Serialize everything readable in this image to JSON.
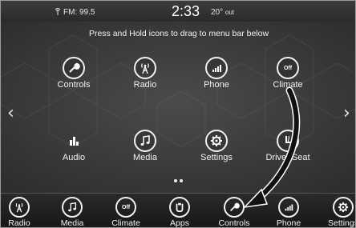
{
  "status": {
    "radio": "FM: 99.5",
    "time": "2:33",
    "temp": "20°",
    "temp_suffix": "out"
  },
  "instruction": "Press and Hold icons to drag to menu bar below",
  "tiles": [
    {
      "label": "Controls",
      "icon": "wrench-icon"
    },
    {
      "label": "Radio",
      "icon": "radio-tower-icon"
    },
    {
      "label": "Phone",
      "icon": "phone-signal-icon"
    },
    {
      "label": "Climate",
      "icon": "climate-off-icon",
      "icon_text": "Off"
    },
    {
      "label": "Audio",
      "icon": "equalizer-icon"
    },
    {
      "label": "Media",
      "icon": "music-note-icon"
    },
    {
      "label": "Settings",
      "icon": "gear-icon"
    },
    {
      "label": "Driver Seat",
      "icon": "heated-seat-icon"
    }
  ],
  "bottom_bar": [
    {
      "label": "Radio",
      "icon": "radio-tower-icon"
    },
    {
      "label": "Media",
      "icon": "music-note-icon"
    },
    {
      "label": "Climate",
      "icon": "climate-off-icon",
      "icon_text": "Off"
    },
    {
      "label": "Apps",
      "icon": "apps-icon"
    },
    {
      "label": "Controls",
      "icon": "wrench-icon"
    },
    {
      "label": "Phone",
      "icon": "phone-signal-icon"
    },
    {
      "label": "Settings",
      "icon": "gear-icon"
    }
  ],
  "nav": {
    "left": "‹",
    "right": "›"
  },
  "colors": {
    "background": "#2f2f2f",
    "foreground": "#ffffff",
    "arrow": "#111111"
  }
}
